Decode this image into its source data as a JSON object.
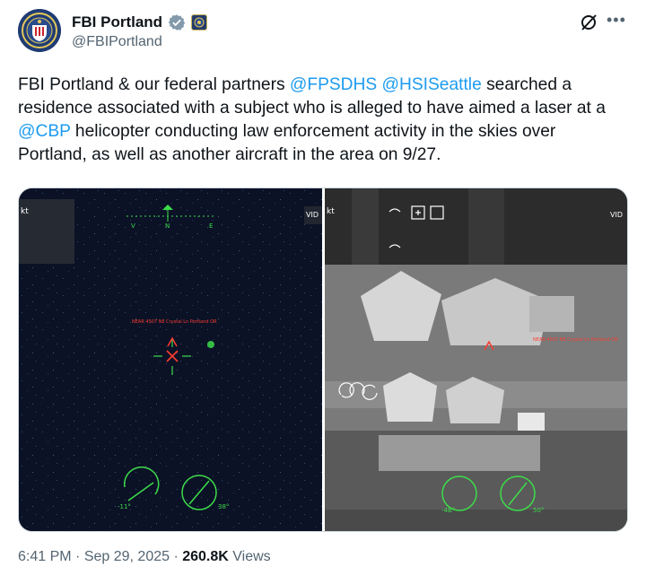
{
  "author": {
    "name": "FBI Portland",
    "handle": "@FBIPortland"
  },
  "tweet": {
    "text_before": "FBI Portland & our federal partners ",
    "mention1": "@FPSDHS",
    "space1": " ",
    "mention2": "@HSISeattle",
    "text_middle": " searched a residence associated with a subject who is alleged to have aimed a laser at a ",
    "mention3": "@CBP",
    "text_after": " helicopter conducting law enforcement activity in the skies over Portland, as well as another aircraft in the area on 9/27."
  },
  "left_image": {
    "corner_label": "kt",
    "right_label": "VID",
    "compass": [
      "V",
      "N",
      "E"
    ],
    "target_text": "NEAR 4507 NE Crystal Ln Portland OR",
    "bottom_left": "-11°",
    "bottom_right": "38°"
  },
  "right_image": {
    "corner_label": "kt",
    "right_label": "VID",
    "target_text": "NEAR 4507 NE Crystal Ln Portland OR",
    "bottom_left": "-4B°",
    "bottom_right": "50°"
  },
  "meta": {
    "time": "6:41 PM",
    "sep1": " · ",
    "date": "Sep 29, 2025",
    "sep2": " · ",
    "views": "260.8K",
    "views_label": " Views"
  },
  "colors": {
    "mention": "#1d9bf0",
    "verified": "#829aab",
    "hud_green": "#3ddc4a",
    "hud_red": "#ff3b2f"
  }
}
